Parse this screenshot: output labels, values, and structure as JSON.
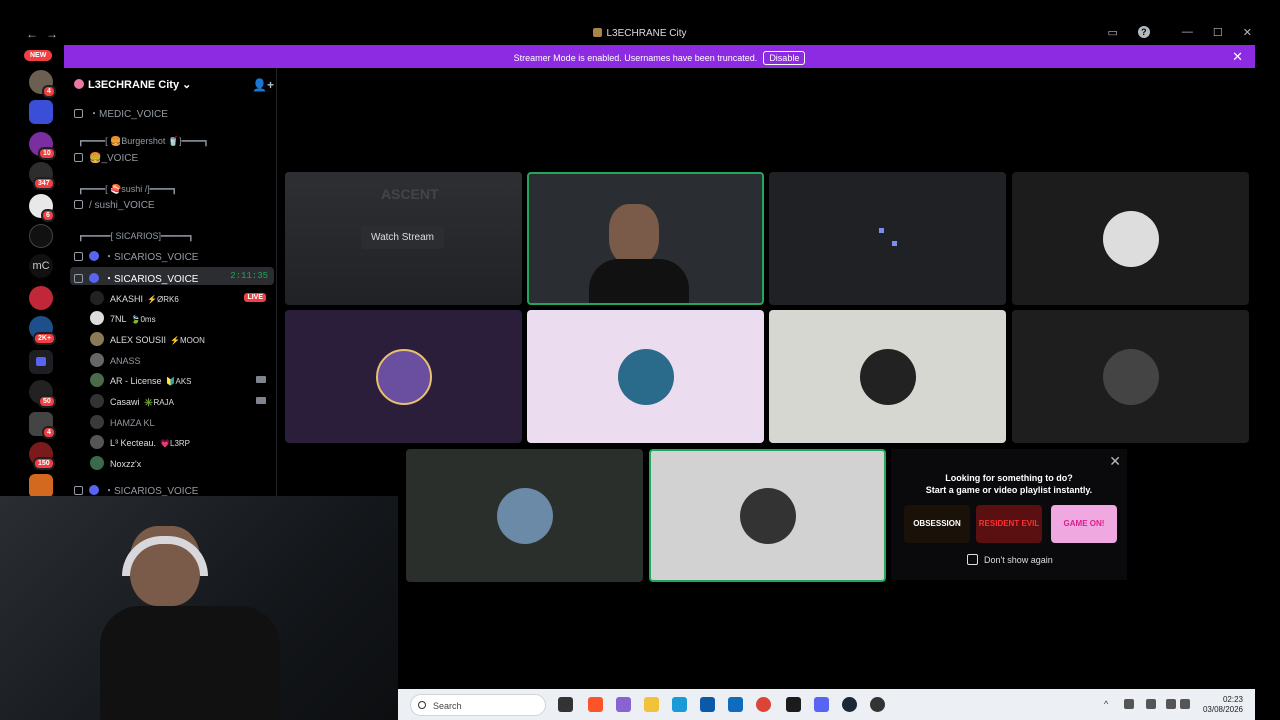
{
  "window": {
    "title": "L3ECHRANE City",
    "nav_back": "←",
    "nav_forward": "→"
  },
  "streamer_banner": {
    "message": "Streamer Mode is enabled. Usernames have been truncated.",
    "button": "Disable"
  },
  "server_rail": {
    "new_label": "NEW",
    "badges": [
      "4",
      "10",
      "347",
      "6",
      "50",
      "4",
      "150",
      "2K+"
    ],
    "text_icons": [
      "mC"
    ]
  },
  "sidebar": {
    "guild_name": "L3ECHRANE City",
    "channels": [
      {
        "name": "・MEDIC_VOICE"
      },
      {
        "category": "┏━━━━[ 🍔Burgershot 🥤]━━━━┓"
      },
      {
        "name": "🍔_VOICE"
      },
      {
        "category": "┏━━━━[ 🍣sushi /]━━━━┓"
      },
      {
        "name": "/ sushi_VOICE"
      },
      {
        "category": "┏━━━━━[ SICARIOS]━━━━━┓"
      },
      {
        "name": "・SICARIOS_VOICE"
      },
      {
        "name": "・SICARIOS_VOICE",
        "time": "2:11:35"
      },
      {
        "name": "・SICARIOS_VOICE"
      }
    ],
    "members": [
      {
        "name": "AKASHI",
        "tag": "⚡ØRK6",
        "live": "LIVE"
      },
      {
        "name": "7NL",
        "tag": "🍃0ms"
      },
      {
        "name": "ALEX SOUSII",
        "tag": "⚡MOON"
      },
      {
        "name": "ANASS",
        "tag": ""
      },
      {
        "name": "AR - License",
        "tag": "🔰AKS"
      },
      {
        "name": "Casawi",
        "tag": "✳️RAJA"
      },
      {
        "name": "HAMZA KL",
        "tag": ""
      },
      {
        "name": "L³ Kecteau.",
        "tag": "💗L3RP"
      },
      {
        "name": "Noxzz'x",
        "tag": ""
      }
    ]
  },
  "stream": {
    "watch_label": "Watch Stream",
    "game_title": "ASCENT"
  },
  "activity": {
    "heading": "Looking for something to do?",
    "subheading": "Start a game or video playlist instantly.",
    "games": [
      "OBSESSION",
      "RESIDENT EVIL",
      "GAME ON!"
    ],
    "dont_show": "Don't show again"
  },
  "taskbar": {
    "search_placeholder": "Search",
    "time": "02:23",
    "date": "03/08/2026"
  },
  "colors": {
    "accent": "#8c2be2",
    "speaking": "#23a55a",
    "danger": "#f23f43",
    "blurple": "#5865f2"
  }
}
